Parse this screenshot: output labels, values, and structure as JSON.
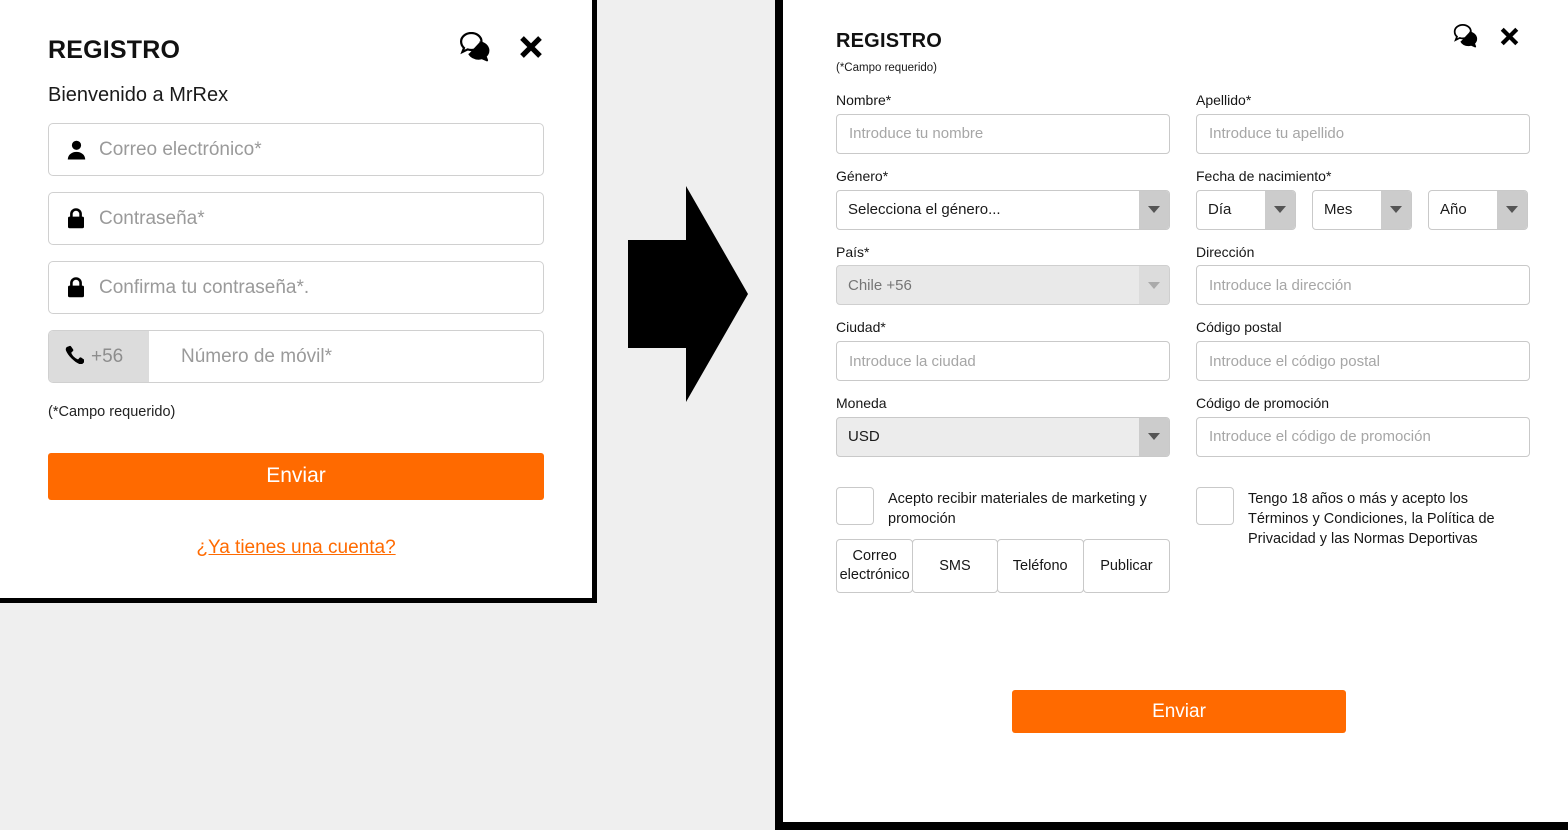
{
  "left_panel": {
    "title": "REGISTRO",
    "welcome": "Bienvenido a MrRex",
    "icons": {
      "chat": "chat-bubbles-icon",
      "close": "close-x-icon"
    },
    "fields": [
      {
        "icon": "user-icon",
        "placeholder": "Correo electrónico*"
      },
      {
        "icon": "lock-icon",
        "placeholder": "Contraseña*"
      },
      {
        "icon": "lock-icon",
        "placeholder": "Confirma tu contraseña*."
      }
    ],
    "phone": {
      "icon": "phone-icon",
      "prefix": "+56",
      "placeholder": "Número de móvil*"
    },
    "required_note": "(*Campo requerido)",
    "submit_label": "Enviar",
    "account_link": "¿Ya tienes una cuenta?"
  },
  "arrow": {
    "name": "right-arrow",
    "color": "#000000"
  },
  "right_panel": {
    "title": "REGISTRO",
    "required_note": "(*Campo requerido)",
    "icons": {
      "chat": "chat-bubbles-icon",
      "close": "close-x-icon"
    },
    "fields": {
      "first_name": {
        "label": "Nombre*",
        "placeholder": "Introduce tu nombre",
        "value": ""
      },
      "last_name": {
        "label": "Apellido*",
        "placeholder": "Introduce tu apellido",
        "value": ""
      },
      "gender": {
        "label": "Género*",
        "value": "Selecciona el género..."
      },
      "birth_date": {
        "label": "Fecha de nacimiento*",
        "day": "Día",
        "month": "Mes",
        "year": "Año"
      },
      "country": {
        "label": "País*",
        "value": "Chile +56",
        "disabled": true
      },
      "address": {
        "label": "Dirección",
        "placeholder": "Introduce la dirección",
        "value": ""
      },
      "city": {
        "label": "Ciudad*",
        "placeholder": "Introduce la ciudad",
        "value": ""
      },
      "postal_code": {
        "label": "Código postal",
        "placeholder": "Introduce el código postal",
        "value": ""
      },
      "currency": {
        "label": "Moneda",
        "value": "USD"
      },
      "promo_code": {
        "label": "Código de promoción",
        "placeholder": "Introduce el código de promoción",
        "value": ""
      }
    },
    "consents": {
      "marketing": {
        "text": "Acepto recibir materiales de marketing y promoción",
        "checked": false
      },
      "age_terms": {
        "text": "Tengo 18 años o más y acepto los Términos y Condiciones, la Política de Privacidad y las Normas Deportivas",
        "checked": false
      }
    },
    "contact_preferences": [
      "Correo electrónico",
      "SMS",
      "Teléfono",
      "Publicar"
    ],
    "submit_label": "Enviar"
  },
  "colors": {
    "accent_orange": "#ff6a00",
    "page_background": "#efefef",
    "panel_border": "#000000",
    "input_border": "#c9c9c9",
    "placeholder_text": "#a6a6a6",
    "dropdown_button": "#cccccc",
    "disabled_field": "#e9e9e9"
  }
}
